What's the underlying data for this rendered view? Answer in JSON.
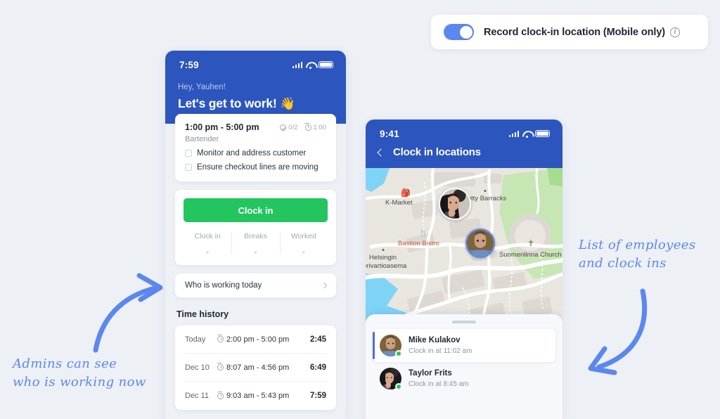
{
  "toggle_card": {
    "enabled": true,
    "label": "Record clock-in location (Mobile only)",
    "info_glyph": "i",
    "accent": "#5b87ef"
  },
  "phone_left": {
    "status_bar": {
      "time": "7:59"
    },
    "greeting": "Hey, Yauhen!",
    "title": "Let's get to work! 👋",
    "shift": {
      "time": "1:00 pm - 5:00 pm",
      "tasks_done": "0/2",
      "break_time": "1:00",
      "role": "Bartender",
      "tasks": [
        "Monitor and address customer",
        "Ensure checkout lines are moving"
      ]
    },
    "clock_in": {
      "button_label": "Clock in",
      "button_color": "#22c55e",
      "stats": [
        {
          "label": "Clock in",
          "value": "-"
        },
        {
          "label": "Breaks",
          "value": "-"
        },
        {
          "label": "Worked",
          "value": "-"
        }
      ]
    },
    "who_working_row": "Who is working today",
    "time_history": {
      "section_title": "Time history",
      "rows": [
        {
          "day": "Today",
          "range": "2:00 pm - 5:00 pm",
          "total": "2:45"
        },
        {
          "day": "Dec 10",
          "range": "8:07 am - 4:56 pm",
          "total": "6:49"
        },
        {
          "day": "Dec 11",
          "range": "9:03 am - 5:43 pm",
          "total": "7:59"
        }
      ]
    }
  },
  "phone_right": {
    "status_bar": {
      "time": "9:41"
    },
    "title": "Clock in locations",
    "map": {
      "pois": [
        {
          "name": "K-Market",
          "kind": "shop"
        },
        {
          "name": "Jetty Barracks",
          "kind": "place"
        },
        {
          "name": "Bastion Bistro",
          "kind": "restaurant"
        },
        {
          "name": "Suomenlinna Church",
          "kind": "church"
        },
        {
          "name": "Helsingin",
          "kind": "place"
        },
        {
          "name": "erivartioasema",
          "kind": "place"
        }
      ],
      "land_color": "#e9e6e0",
      "water_color": "#7fd3f7",
      "park_color": "#c6e7b4"
    },
    "employees": [
      {
        "name": "Mike Kulakov",
        "status": "Clock in at 11:02 am",
        "online": true,
        "selected": true
      },
      {
        "name": "Taylor Frits",
        "status": "Clock in at 8:45 am",
        "online": true,
        "selected": false
      }
    ]
  },
  "annotations": [
    {
      "id": "left-note",
      "line1": "Admins can see",
      "line2": "who is working now"
    },
    {
      "id": "right-note",
      "line1": "List of employees",
      "line2": "and clock ins"
    }
  ]
}
